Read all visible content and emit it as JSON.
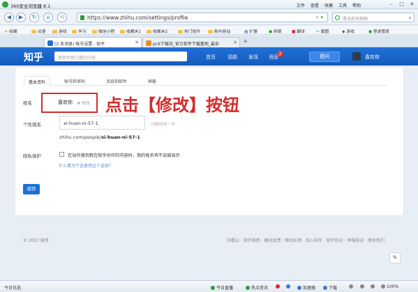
{
  "browser": {
    "title": "360安全浏览器 8.1",
    "menu": [
      "文件",
      "查看",
      "收藏",
      "工具",
      "帮助"
    ],
    "url": "https://www.zhihu.com/settings/profile",
    "search_placeholder": "青岛前海保税",
    "favorites": [
      {
        "label": "收藏",
        "icon": "star-icon"
      },
      {
        "label": "动漫"
      },
      {
        "label": "游戏"
      },
      {
        "label": "学习"
      },
      {
        "label": "微信小程"
      },
      {
        "label": "收藏夹1"
      },
      {
        "label": "收藏夹2"
      },
      {
        "label": "热门软件"
      },
      {
        "label": "新内容站"
      },
      {
        "label": "扩展"
      },
      {
        "label": "网银"
      },
      {
        "label": "翻译"
      },
      {
        "label": "截图"
      },
      {
        "label": "游戏"
      },
      {
        "label": "登录管家"
      }
    ],
    "tabs": [
      {
        "label": "(2 条消息) 帐号设置 - 知乎",
        "icon": "zhihu-icon",
        "active": true
      },
      {
        "label": "pc6下载站_官方软件下载基地_最安",
        "icon": "pc6-icon",
        "active": false
      }
    ],
    "status": {
      "left": "今日优选",
      "items": [
        "今日直播",
        "热点资讯",
        "",
        "",
        "加速器",
        "下载",
        "",
        "",
        "",
        "100%"
      ]
    },
    "colors": {
      "accent": "#1e70d6",
      "annotation": "#d62b2b"
    }
  },
  "zhihu": {
    "logo": "知乎",
    "search_placeholder": "搜索你感兴趣的内容",
    "nav": [
      "首页",
      "话题",
      "发现",
      "消息"
    ],
    "message_count": "2",
    "ask_button": "提问",
    "username": "喜欢你"
  },
  "settings": {
    "tabs": [
      "基本资料",
      "帐号和密码",
      "消息和邮件",
      "屏蔽"
    ],
    "name_label": "姓名",
    "name_value": "喜欢你",
    "edit_link": "修改",
    "annotation": "点击【修改】按钮",
    "bio_label": "个性域名",
    "bio_value": "xi-huan-ni-57-1",
    "bio_hint": "只能修改一次",
    "url_prefix": "zhihu.com/people/",
    "url_slug": "xi-huan-ni-57-1",
    "privacy_label": "隐私保护",
    "privacy_text": "在站外搜到我在知乎创作的内容时，我的姓名将不会被显示",
    "privacy_why": "什么情况下会使用这个选项？",
    "save_button": "保存"
  },
  "footer": {
    "copyright": "© 2017 知乎",
    "links": "刘看山 · 知乎指南 · 建议反馈 · 移动应用 · 加入知乎 · 知乎协议 · 举报投诉 · 联系我们"
  }
}
